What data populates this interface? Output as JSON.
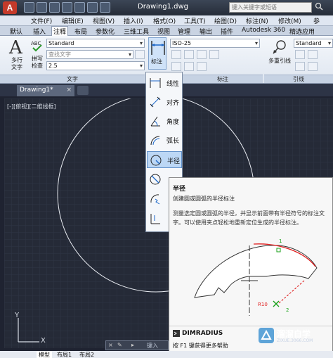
{
  "window": {
    "title": "Drawing1.dwg",
    "search_placeholder": "键入关键字或短语",
    "app_letter": "A"
  },
  "menu": [
    "文件(F)",
    "编辑(E)",
    "视图(V)",
    "插入(I)",
    "格式(O)",
    "工具(T)",
    "绘图(D)",
    "标注(N)",
    "修改(M)",
    "参"
  ],
  "ribbon_tabs": [
    "默认",
    "插入",
    "注释",
    "布局",
    "参数化",
    "三维工具",
    "视图",
    "管理",
    "输出",
    "插件",
    "Autodesk 360",
    "精选应用"
  ],
  "active_tab": "注释",
  "text_panel": {
    "multiline_label": "多行文字",
    "spellcheck_label": "拼写检查",
    "style_value": "Standard",
    "find_placeholder": "查找文字",
    "height_value": "2.5",
    "panel_title": "文字"
  },
  "dim_panel": {
    "button_label": "标注",
    "style_value": "ISO-25",
    "panel_title": "标注"
  },
  "leader_panel": {
    "button_label": "多重引线",
    "style_value": "Standard",
    "panel_title": "引线"
  },
  "dropdown_items": [
    {
      "label": "线性",
      "icon": "linear-dim-icon"
    },
    {
      "label": "对齐",
      "icon": "aligned-dim-icon"
    },
    {
      "label": "角度",
      "icon": "angular-dim-icon"
    },
    {
      "label": "弧长",
      "icon": "arc-length-icon"
    },
    {
      "label": "半径",
      "icon": "radius-dim-icon",
      "selected": true
    },
    {
      "label": "",
      "icon": "diameter-dim-icon"
    },
    {
      "label": "",
      "icon": "jogged-dim-icon"
    },
    {
      "label": "",
      "icon": "ordinate-dim-icon"
    }
  ],
  "doc_tab": {
    "name": "Drawing1*",
    "close": "×"
  },
  "viewport_label": "[-][俯视][二维线框]",
  "tooltip": {
    "title": "半径",
    "description": "创建圆或圆弧的半径标注",
    "long_description": "测量选定圆或圆弧的半径，并显示前面带有半径符号的标注文字。可以使用夹点轻松地重新定位生成的半径标注。",
    "diagram_label_1": "1",
    "diagram_label_2": "2",
    "diagram_dim_text": "R10",
    "command": "DIMRADIUS",
    "help": "按 F1 键获得更多帮助"
  },
  "command_line": {
    "prompt": "键入"
  },
  "layout_tabs": [
    "模型",
    "布局1",
    "布局2"
  ],
  "ucs": {
    "y": "Y",
    "x": "X"
  },
  "watermark": {
    "text": "溜溜自学",
    "sub": "ZIXUE.3066.COM"
  },
  "colors": {
    "canvas": "#252a37",
    "ribbon_accent": "#cfe2f8",
    "selected_item": "#bcd7f5",
    "dim_red": "#e02020",
    "grip_green": "#18a018"
  }
}
